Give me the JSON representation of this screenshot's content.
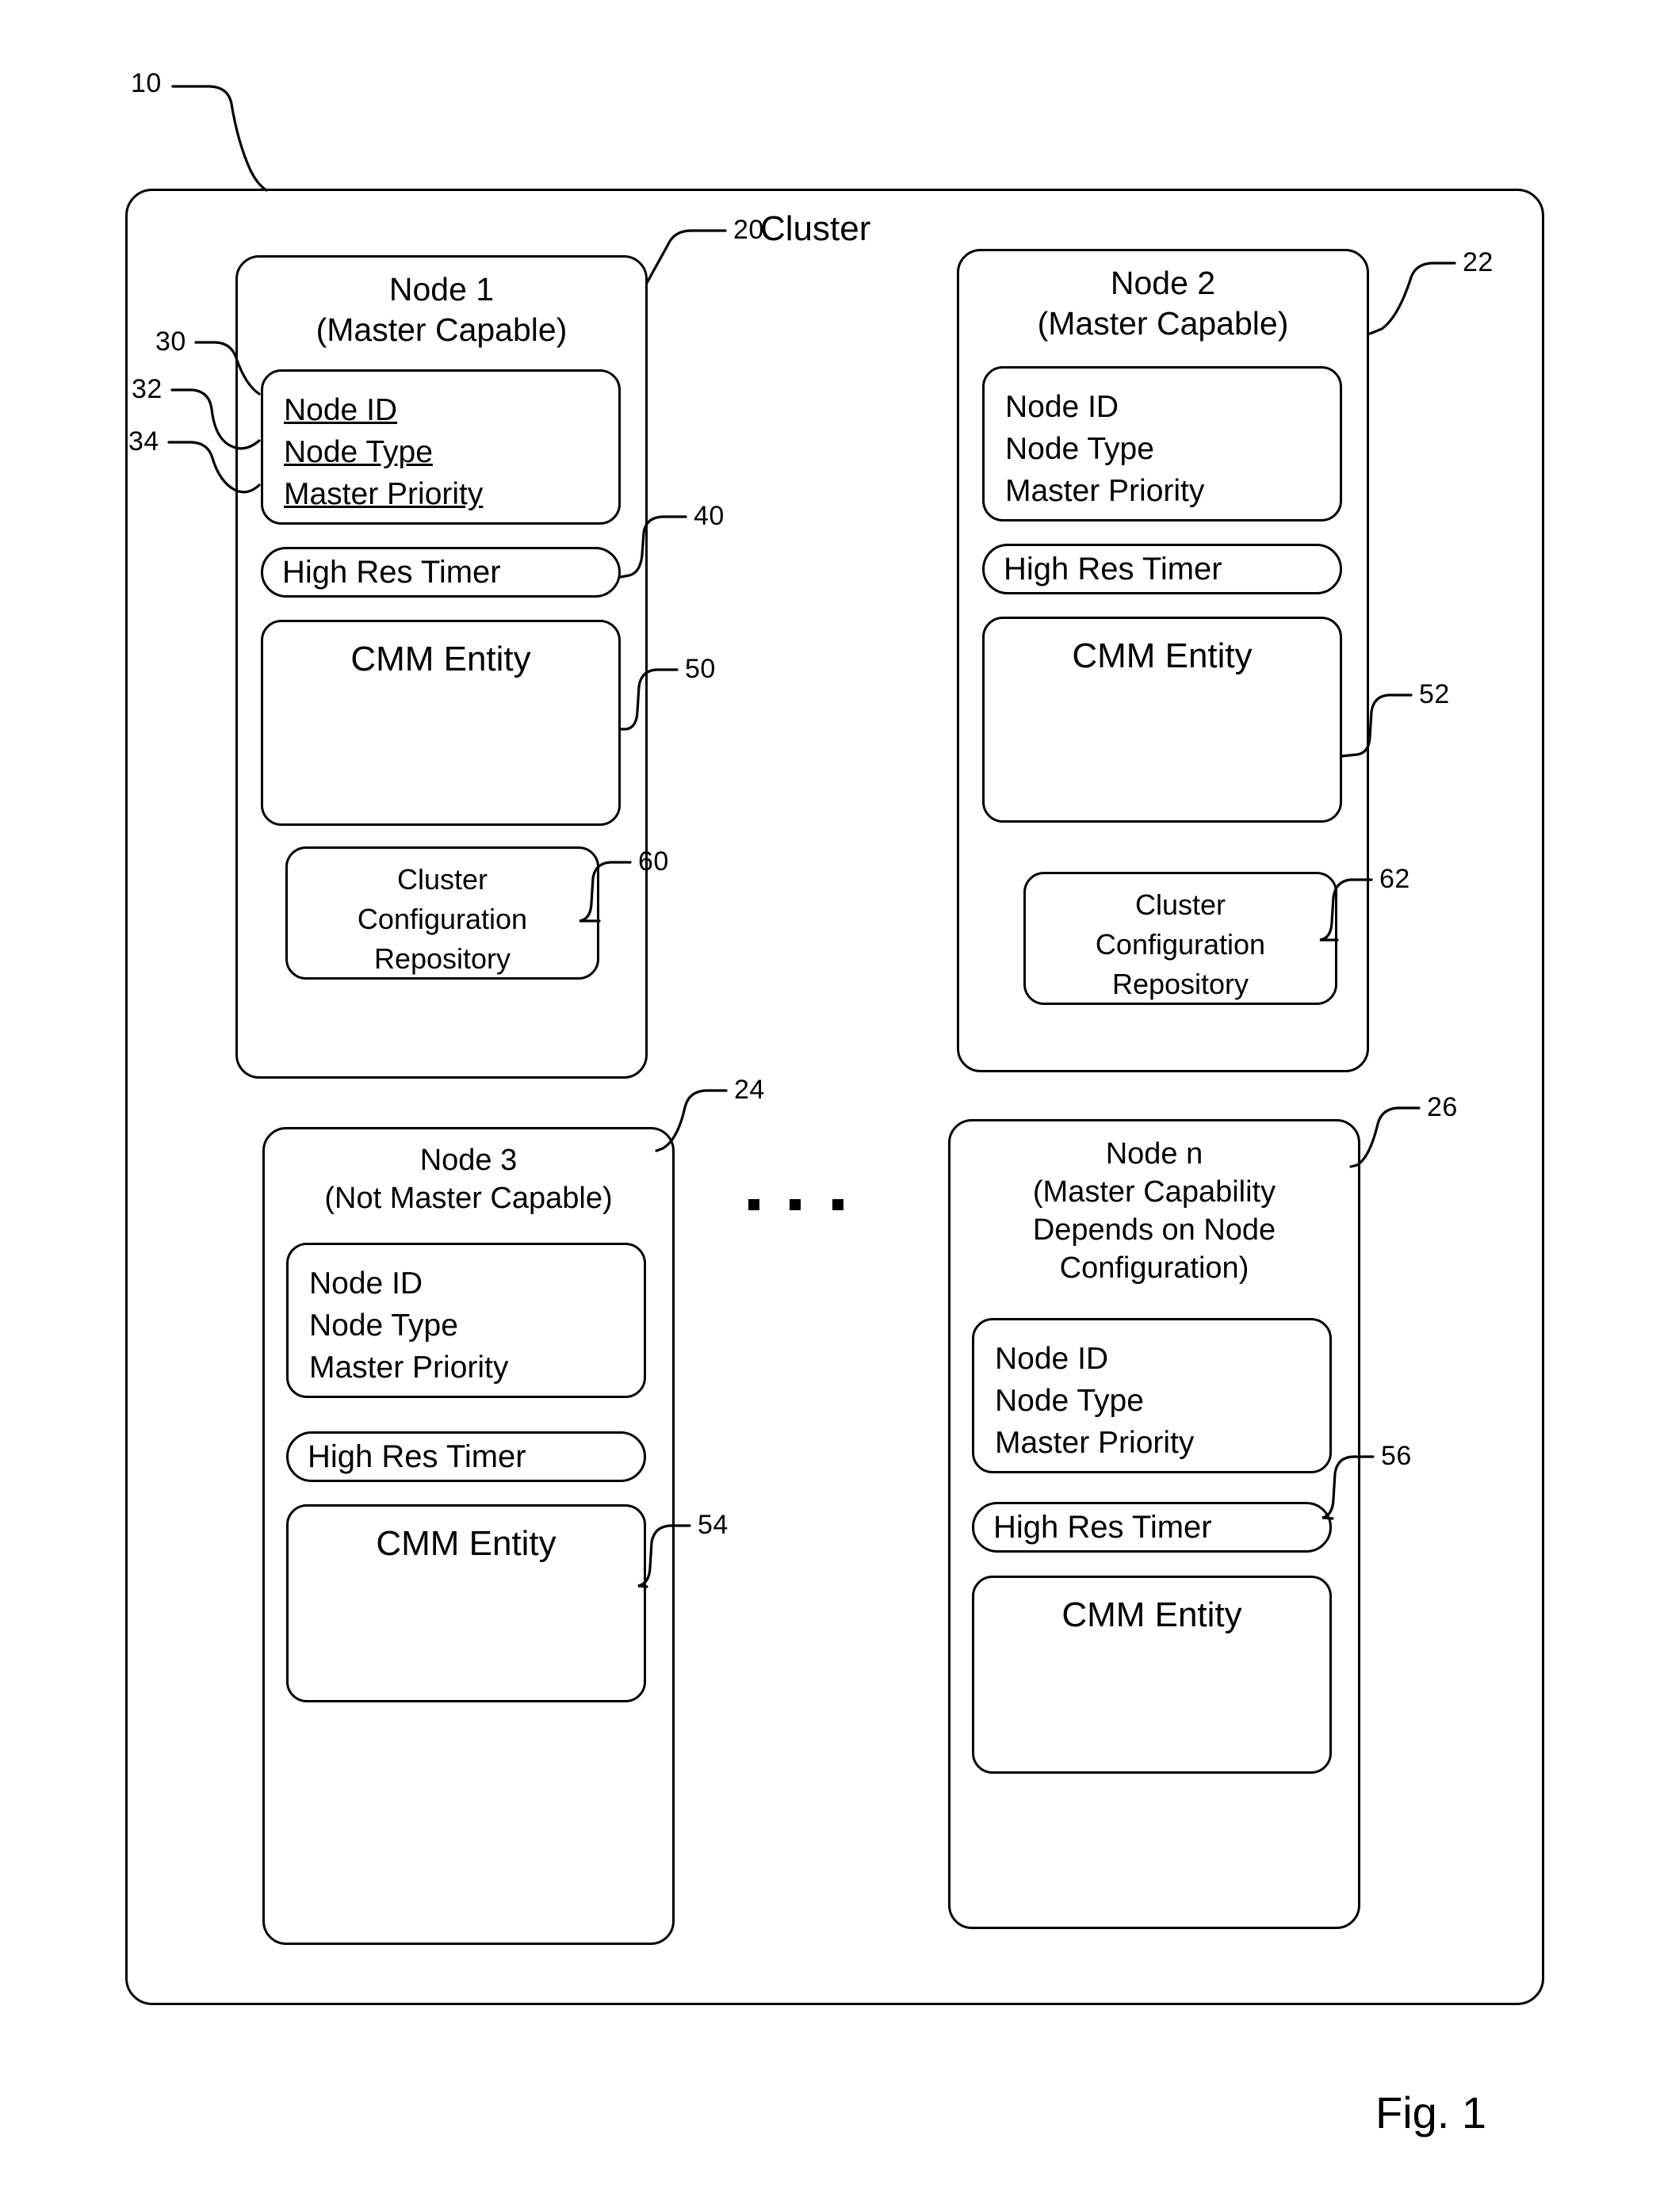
{
  "figure": {
    "caption": "Fig. 1",
    "cluster_label": "Cluster"
  },
  "reference_numerals": {
    "system": "10",
    "cluster": "20",
    "node1": "20",
    "node2": "22",
    "node3": "24",
    "noden": "26",
    "node_id": "30",
    "node_type": "32",
    "master_priority": "34",
    "high_res_timer_1": "40",
    "cmm_entity_1": "50",
    "cmm_entity_2": "52",
    "cmm_entity_3": "54",
    "high_res_timer_n": "56",
    "repository_1": "60",
    "repository_2": "62"
  },
  "attributes": {
    "node_id": "Node ID",
    "node_type": "Node Type",
    "master_priority": "Master Priority"
  },
  "components": {
    "high_res_timer": "High Res Timer",
    "cmm_entity": "CMM Entity",
    "repository": "Cluster\nConfiguration\nRepository"
  },
  "nodes": [
    {
      "id": "node1",
      "title": "Node 1\n(Master Capable)",
      "name": "Node 1",
      "capability": "(Master Capable)",
      "has_repository": true,
      "attributes_underlined": true
    },
    {
      "id": "node2",
      "title": "Node 2\n(Master Capable)",
      "name": "Node 2",
      "capability": "(Master Capable)",
      "has_repository": true,
      "attributes_underlined": false
    },
    {
      "id": "node3",
      "title": "Node 3\n(Not Master Capable)",
      "name": "Node 3",
      "capability": "(Not Master Capable)",
      "has_repository": false,
      "attributes_underlined": false
    },
    {
      "id": "noden",
      "title": "Node n\n(Master Capability\nDepends on Node\nConfiguration)",
      "name": "Node n",
      "capability": "(Master Capability Depends on Node Configuration)",
      "has_repository": false,
      "attributes_underlined": false
    }
  ],
  "ellipsis": "• • •",
  "colors": {
    "stroke": "#000000",
    "background": "#ffffff"
  }
}
